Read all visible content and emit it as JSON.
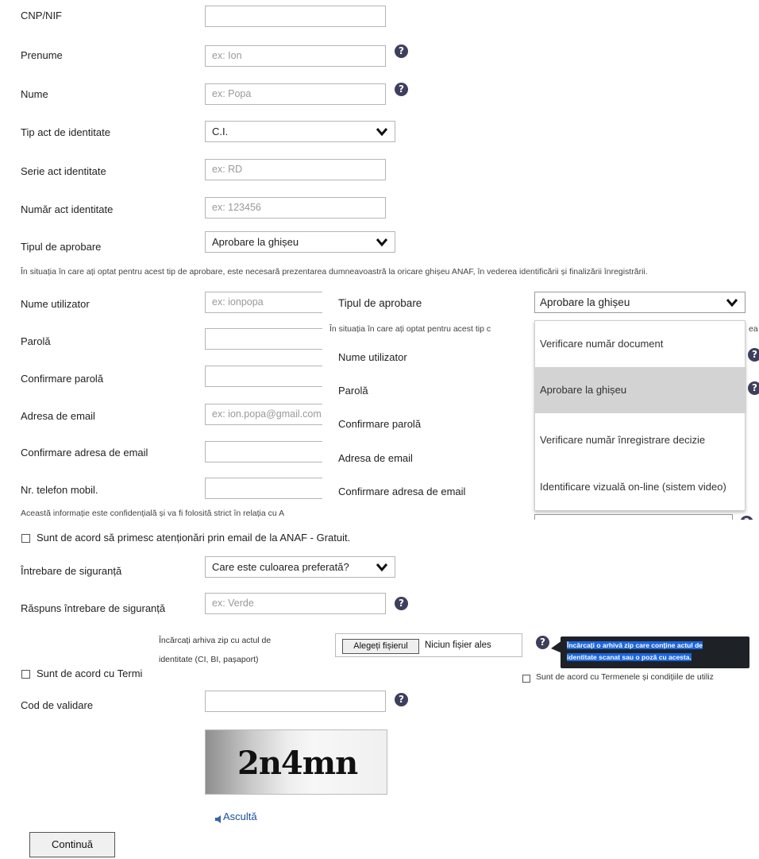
{
  "form": {
    "cnp_label": "CNP/NIF",
    "prenume_label": "Prenume",
    "prenume_placeholder": "ex: Ion",
    "nume_label": "Nume",
    "nume_placeholder": "ex: Popa",
    "tip_act_label": "Tip act de identitate",
    "tip_act_value": "C.I.",
    "serie_label": "Serie act identitate",
    "serie_placeholder": "ex: RD",
    "numar_label": "Număr act identitate",
    "numar_placeholder": "ex: 123456",
    "tip_aprobare_label": "Tipul de aprobare",
    "tip_aprobare_value": "Aprobare la ghișeu",
    "aprobare_note": "În situația în care ați optat pentru acest tip de aprobare, este necesară prezentarea dumneavoastră la oricare ghișeu ANAF, în vederea identificării și finalizării înregistrării.",
    "user_label": "Nume utilizator",
    "user_placeholder": "ex: ionpopa",
    "parola_label": "Parolă",
    "confirm_parola_label": "Confirmare parolă",
    "email_label": "Adresa de email",
    "email_placeholder": "ex: ion.popa@gmail.com",
    "confirm_email_label": "Confirmare adresa de email",
    "telefon_label": "Nr. telefon mobil.",
    "confidential_note": "Această informație este confidențială și va fi folosită strict în relația cu A",
    "notify_checkbox_label": "Sunt de acord să primesc atenționări prin email de la ANAF - Gratuit.",
    "intrebare_label": "Întrebare de siguranță",
    "intrebare_value": "Care este culoarea preferată?",
    "raspuns_label": "Răspuns întrebare de siguranță",
    "raspuns_placeholder": "ex: Verde",
    "terms_checkbox_label": "Sunt de acord cu Termi",
    "cod_label": "Cod de validare",
    "captcha_text": "2n4mn",
    "asculta_label": "Ascultă",
    "continua_label": "Continuă"
  },
  "overlay": {
    "tip_aprobare_label": "Tipul de aprobare",
    "tip_aprobare_value": "Aprobare la ghișeu",
    "note": "În situația în care ați optat pentru acest tip c",
    "note_tail": "ea",
    "user_label": "Nume utilizator",
    "parola_label": "Parolă",
    "confirm_parola_label": "Confirmare parolă",
    "email_label": "Adresa de email",
    "confirm_email_label": "Confirmare adresa de email",
    "dropdown_options": [
      "Verificare număr document",
      "Aprobare la ghișeu",
      "Verificare număr înregistrare decizie",
      "Identificare vizuală on-line (sistem video)"
    ],
    "selected_index": 1
  },
  "upload": {
    "label_line1": "Încărcați arhiva zip cu actul de",
    "label_line2": "identitate (CI, BI, pașaport)",
    "choose_button": "Alegeți fișierul",
    "no_file_text": "Niciun fișier ales",
    "tooltip_line1": "Încărcați o arhivă zip care conține actul de",
    "tooltip_line2": "identitate scanat sau o poză cu acesta.",
    "terms_overlap_label": "Sunt de acord cu Termenele și condițiile de utiliz"
  },
  "colors": {
    "help_icon_bg": "#3d3f5c",
    "dropdown_selected_bg": "#d3d3d3",
    "tooltip_bg": "#1e2227",
    "tooltip_text_highlight": "#1a66e0",
    "link_blue": "#1a4fa0"
  }
}
